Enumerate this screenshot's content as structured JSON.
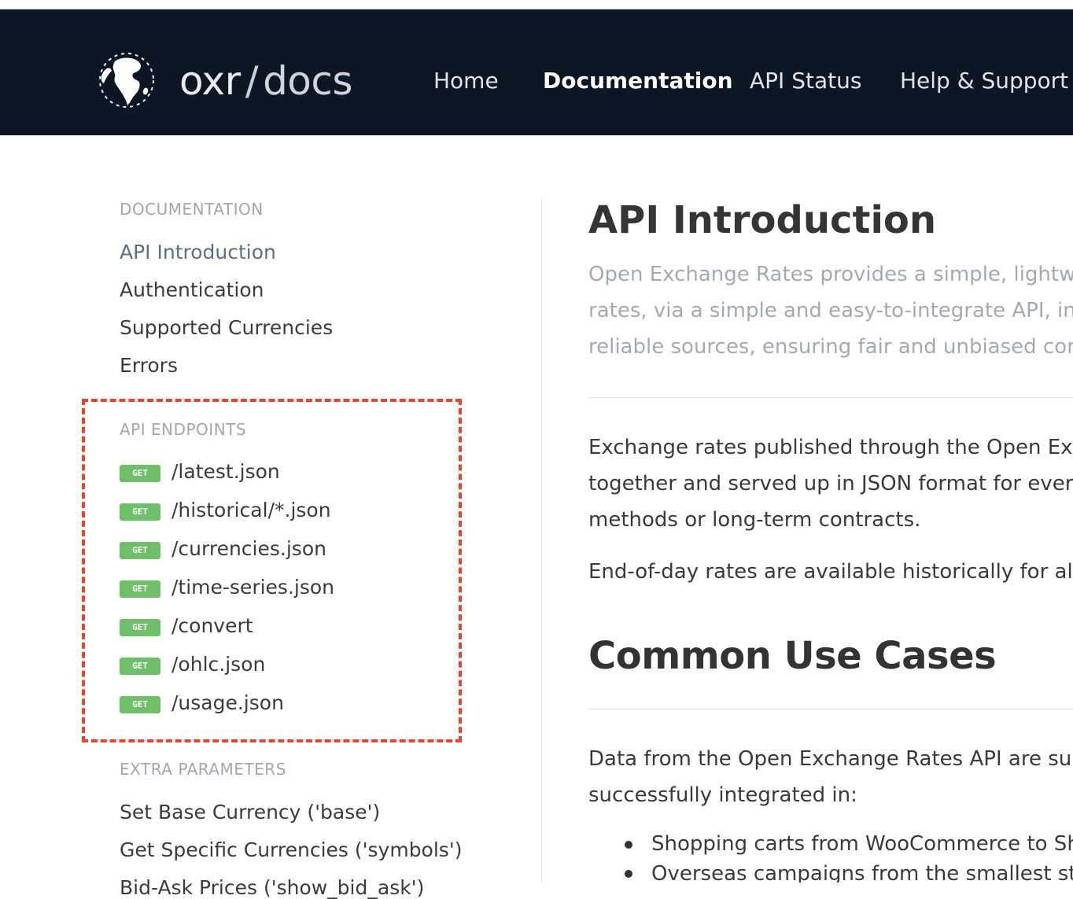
{
  "header": {
    "brand_name": "oxr",
    "brand_slash": "/",
    "brand_section": "docs",
    "logo_icon": "globe-icon",
    "nav": [
      {
        "label": "Home",
        "active": false
      },
      {
        "label": "Documentation",
        "active": true
      },
      {
        "label": "API Status",
        "active": false
      },
      {
        "label": "Help & Support",
        "active": false
      }
    ]
  },
  "sidebar": {
    "documentation_heading": "DOCUMENTATION",
    "documentation_links": [
      "API Introduction",
      "Authentication",
      "Supported Currencies",
      "Errors"
    ],
    "endpoints_heading": "API ENDPOINTS",
    "endpoints": [
      {
        "method": "GET",
        "path": "/latest.json"
      },
      {
        "method": "GET",
        "path": "/historical/*.json"
      },
      {
        "method": "GET",
        "path": "/currencies.json"
      },
      {
        "method": "GET",
        "path": "/time-series.json"
      },
      {
        "method": "GET",
        "path": "/convert"
      },
      {
        "method": "GET",
        "path": "/ohlc.json"
      },
      {
        "method": "GET",
        "path": "/usage.json"
      }
    ],
    "extra_heading": "EXTRA PARAMETERS",
    "extra_links": [
      "Set Base Currency ('base')",
      "Get Specific Currencies ('symbols')",
      "Bid-Ask Prices ('show_bid_ask')"
    ]
  },
  "main": {
    "title": "API Introduction",
    "lead_lines": [
      "Open Exchange Rates provides a simple, lightwe",
      "rates, via a simple and easy-to-integrate API, in J",
      "reliable sources, ensuring fair and unbiased cor"
    ],
    "para1_lines": [
      "Exchange rates published through the Open Exc",
      "together and served up in JSON format for every",
      "methods or long-term contracts."
    ],
    "para2": "End-of-day rates are available historically for all",
    "section_title": "Common Use Cases",
    "para3_lines": [
      "Data from the Open Exchange Rates API are sui",
      "successfully integrated in:"
    ],
    "use_cases": [
      "Shopping carts from WooCommerce to Sh",
      "Overseas campaigns from the smallest st"
    ]
  },
  "colors": {
    "navbar_bg": "#0d1623",
    "get_badge": "#6fbe68",
    "highlight_border": "#e8452c"
  }
}
